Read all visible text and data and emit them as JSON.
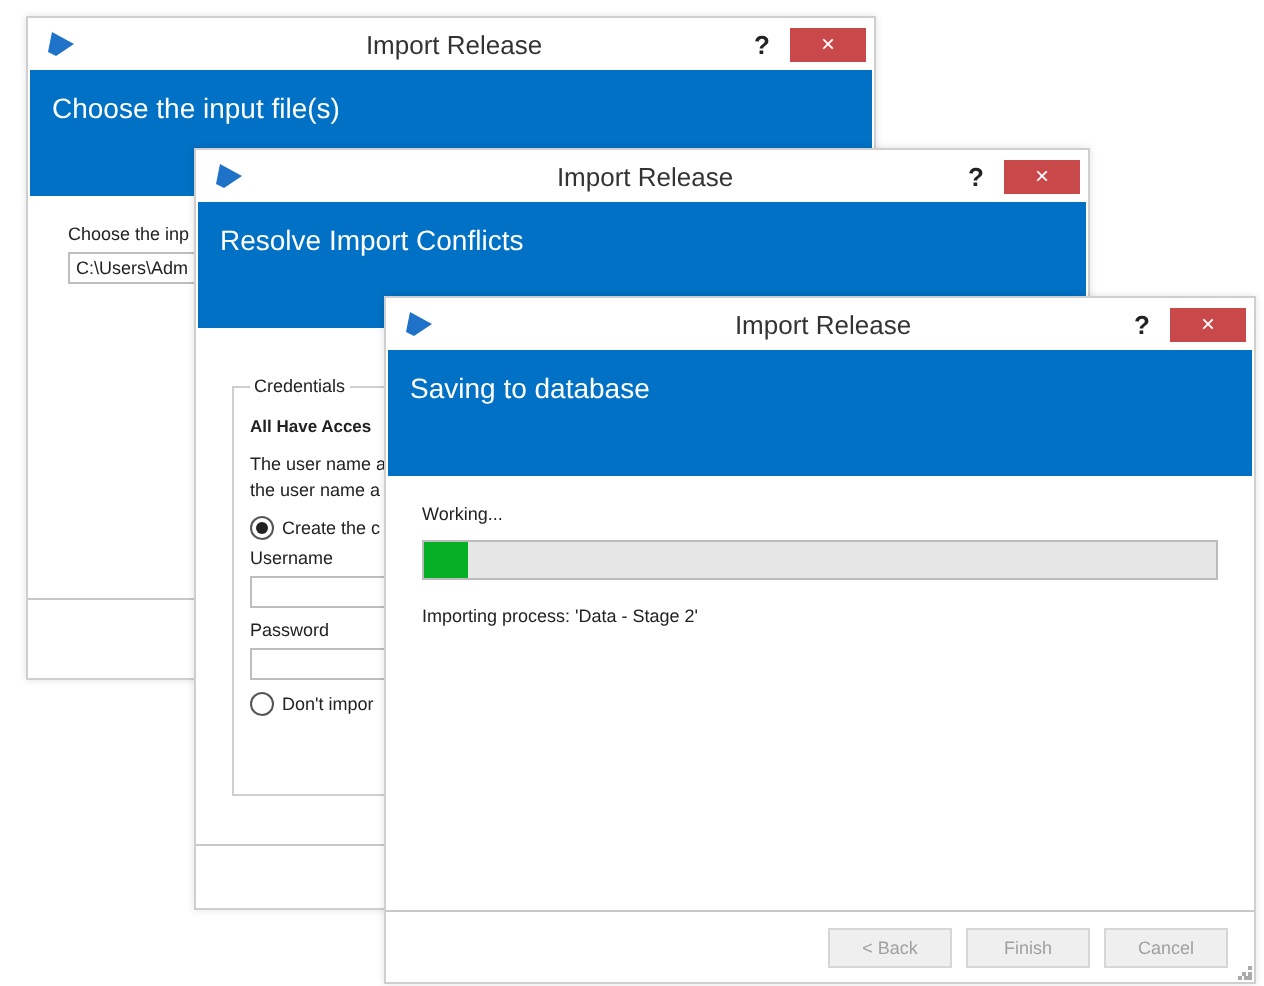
{
  "windows": [
    {
      "title": "Import Release",
      "help": "?",
      "close": "×",
      "header": "Choose the input file(s)",
      "body": [
        {
          "kind": "label",
          "text": "Choose the inp"
        },
        {
          "kind": "field",
          "value": "C:\\Users\\Adm"
        }
      ]
    },
    {
      "title": "Import Release",
      "help": "?",
      "close": "×",
      "header": "Resolve Import Conflicts",
      "body": [
        {
          "kind": "group",
          "legend": "Credentials",
          "children": [
            {
              "kind": "bold",
              "text": "All Have Acces"
            },
            {
              "kind": "text",
              "text": "The user name a"
            },
            {
              "kind": "text",
              "text": "the user name a"
            },
            {
              "kind": "radio",
              "label": "Create the c",
              "selected": true
            },
            {
              "kind": "label",
              "text": "Username"
            },
            {
              "kind": "field"
            },
            {
              "kind": "label",
              "text": "Password"
            },
            {
              "kind": "field"
            },
            {
              "kind": "radio",
              "label": "Don't impor",
              "selected": false
            }
          ]
        }
      ]
    },
    {
      "title": "Import Release",
      "help": "?",
      "close": "×",
      "header": "Saving to database",
      "body": [
        {
          "kind": "label",
          "text": "Working..."
        },
        {
          "kind": "progress",
          "level": 0.055
        },
        {
          "kind": "text",
          "text": "Importing process: 'Data - Stage 2'"
        }
      ],
      "buttons": [
        {
          "label": "< Back",
          "disabled": true
        },
        {
          "label": "Finish",
          "disabled": true
        },
        {
          "label": "Cancel",
          "disabled": true
        }
      ]
    }
  ]
}
